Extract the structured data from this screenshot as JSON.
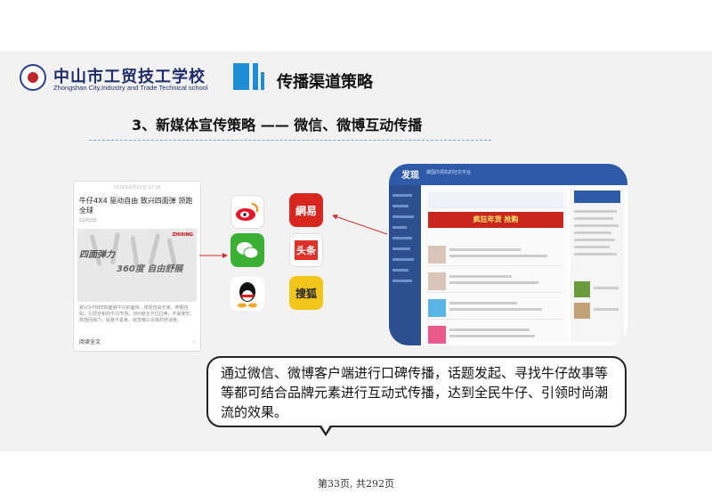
{
  "header": {
    "school_cn": "中山市工贸技工学校",
    "school_en": "Zhongshan City,Industry and Trade Technical school",
    "section_title": "传播渠道策略"
  },
  "subtitle": "3、新媒体宣传策略 —— 微信、微博互动传播",
  "article": {
    "timestamp": "2016年6月12日 17:25",
    "title": "牛仔4X4 驱动自由 致兴四面弹 领跑全球",
    "date": "12月2日",
    "ad_line1": "四面弹力",
    "ad_line2": "360度 自由舒展",
    "brand": "ZHIXING",
    "body": "致兴X-FREE四面弹牛仔的面世，体现自由无束，伸展自如，引领全新的牛仔市场。360度全方位拉伸，不易变形，高值回弹力，贴身不紧束，给您难以言喻的舒适度。",
    "read_more": "阅读全文",
    "arrow": "›"
  },
  "apps": {
    "wangyi": "網易",
    "toutiao": "头条",
    "sohu": "搜狐"
  },
  "web": {
    "logo": "发现",
    "slogan": "做国内领先的社交平台",
    "banner": "疯狂年货 抢购"
  },
  "callout": "通过微信、微博客户端进行口碑传播，话题发起、寻找牛仔故事等等都可结合品牌元素进行互动式传播，达到全民牛仔、引领时尚潮流的效果。",
  "page_number": "第33页, 共292页",
  "colors": {
    "accent": "#1f8dd6",
    "school": "#1f2d6b",
    "arrow": "#d0302a"
  }
}
